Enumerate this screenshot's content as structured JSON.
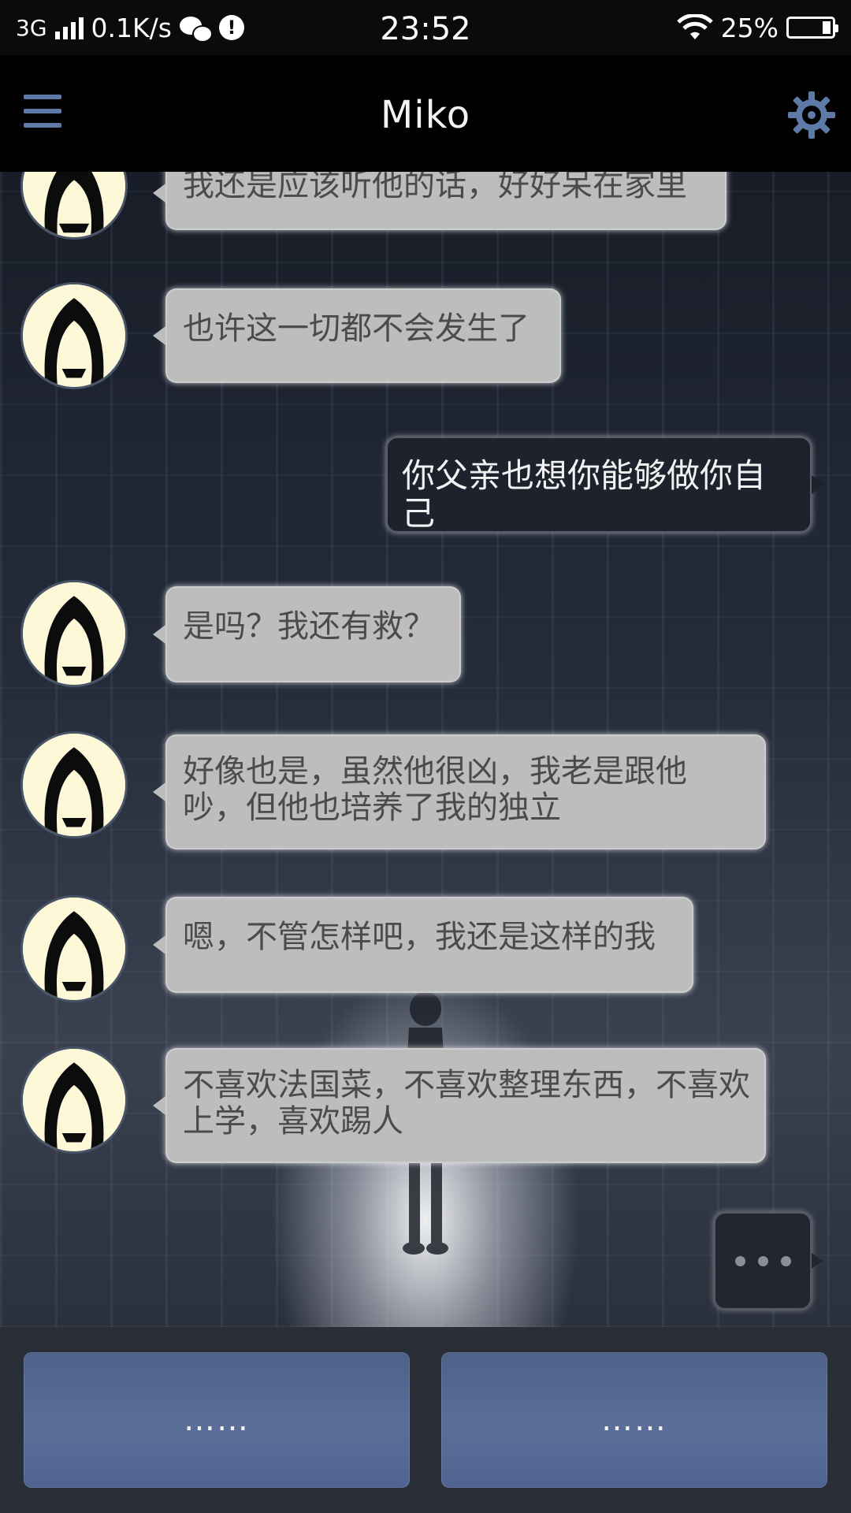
{
  "status_bar": {
    "network": "3G",
    "speed": "0.1K/s",
    "time": "23:52",
    "battery": "25%",
    "alert_icon": "!"
  },
  "app_bar": {
    "title": "Miko"
  },
  "messages": [
    {
      "side": "in",
      "text": "我还是应该听他的话，好好呆在家里"
    },
    {
      "side": "in",
      "text": "也许这一切都不会发生了"
    },
    {
      "side": "out",
      "text": "你父亲也想你能够做你自己"
    },
    {
      "side": "in",
      "text": "是吗？我还有救？"
    },
    {
      "side": "in",
      "text": "好像也是，虽然他很凶，我老是跟他吵，但他也培养了我的独立"
    },
    {
      "side": "in",
      "text": "嗯，不管怎样吧，我还是这样的我"
    },
    {
      "side": "in",
      "text": "不喜欢法国菜，不喜欢整理东西，不喜欢上学，喜欢踢人"
    }
  ],
  "reply_options": [
    {
      "label": "……"
    },
    {
      "label": "……"
    }
  ],
  "colors": {
    "accent": "#5e7aa6",
    "incoming_bubble": "#bdbdbd",
    "outgoing_bubble": "#1d222c",
    "reply_button": "#5a6f98"
  },
  "icons": [
    "menu-icon",
    "gear-icon",
    "wechat-icon",
    "alert-icon",
    "wifi-icon",
    "battery-icon",
    "typing-indicator"
  ]
}
